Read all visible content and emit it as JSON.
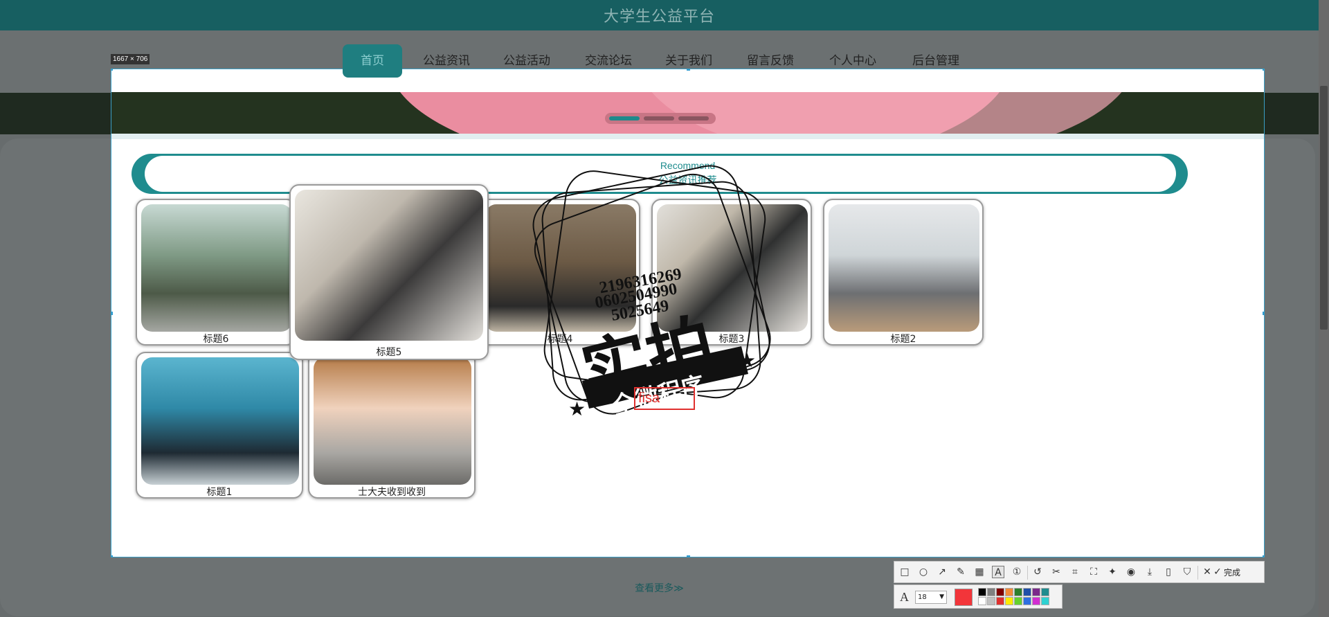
{
  "site": {
    "title": "大学生公益平台"
  },
  "nav": {
    "items": [
      {
        "label": "首页",
        "active": true
      },
      {
        "label": "公益资讯"
      },
      {
        "label": "公益活动"
      },
      {
        "label": "交流论坛"
      },
      {
        "label": "关于我们"
      },
      {
        "label": "留言反馈"
      },
      {
        "label": "个人中心"
      },
      {
        "label": "后台管理"
      }
    ]
  },
  "carousel": {
    "slides": 3,
    "active_slide": 1
  },
  "recommend": {
    "title": "Recommend",
    "subtitle": "公益资讯推荐"
  },
  "cards": [
    {
      "title": "标题6",
      "image": "group-photo-mountain"
    },
    {
      "title": "标题5",
      "image": "library-event-photo"
    },
    {
      "title": "标题4",
      "image": "outdoor-group-photo"
    },
    {
      "title": "标题3",
      "image": "library-event-photo"
    },
    {
      "title": "标题2",
      "image": "computer-lab-photo"
    },
    {
      "title": "标题1",
      "image": "conference-group-photo"
    },
    {
      "title": "士大夫收到收到",
      "image": "portrait-photo"
    }
  ],
  "watermark": {
    "numbers": [
      "2196316269",
      "0602504990",
      "5025649"
    ],
    "main": "实拍",
    "banner": "全微程序"
  },
  "more_link": "查看更多≫",
  "capture": {
    "size_label": "1667 × 706",
    "text_input": "fisa"
  },
  "toolbar": {
    "tools": [
      "rectangle-icon",
      "ellipse-icon",
      "arrow-icon",
      "pencil-icon",
      "mosaic-icon",
      "text-icon",
      "number-icon",
      "undo-icon",
      "magic-icon",
      "ocr-icon",
      "scroll-icon",
      "pin-icon",
      "record-icon",
      "download-icon",
      "phone-icon",
      "save-icon",
      "cancel-icon"
    ],
    "done_label": "完成",
    "font_size": "18",
    "current_color": "#f2353a",
    "colors": [
      "#000000",
      "#808080",
      "#800000",
      "#f28c3a",
      "#2c7f2c",
      "#1f4fa8",
      "#7a2a8a",
      "#1f8c8e",
      "#ffffff",
      "#c0c0c0",
      "#e0302e",
      "#ffeb00",
      "#65d12e",
      "#2e6fe0",
      "#d12ed1",
      "#2ed1d1"
    ]
  }
}
